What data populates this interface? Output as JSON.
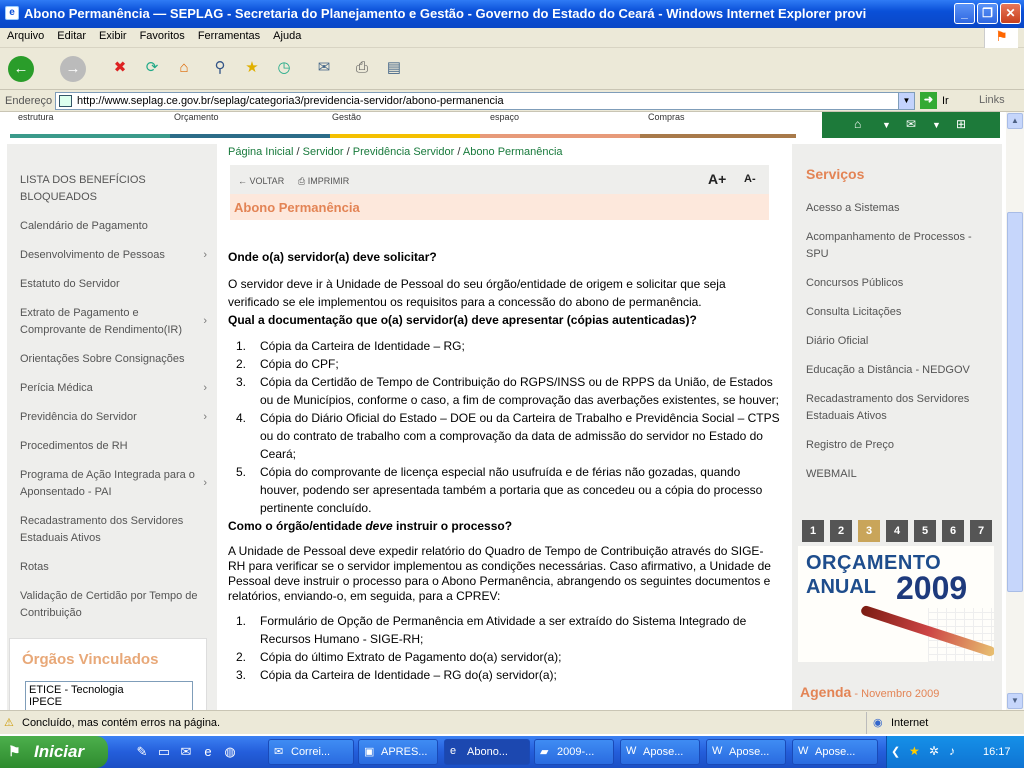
{
  "window": {
    "title": "Abono Permanência — SEPLAG - Secretaria do Planejamento e Gestão - Governo do Estado do Ceará - Windows Internet Explorer provi"
  },
  "menu": [
    "Arquivo",
    "Editar",
    "Exibir",
    "Favoritos",
    "Ferramentas",
    "Ajuda"
  ],
  "address": {
    "label": "Endereço",
    "url": "http://www.seplag.ce.gov.br/seplag/categoria3/previdencia-servidor/abono-permanencia",
    "go": "Ir",
    "links": "Links"
  },
  "topnav": [
    "estrutura",
    "Orçamento",
    "Gestão",
    "espaço",
    "Compras"
  ],
  "left_nav": {
    "items": [
      "LISTA DOS BENEFÍCIOS BLOQUEADOS",
      "Calendário de Pagamento",
      "Desenvolvimento de Pessoas",
      "Estatuto do Servidor",
      "Extrato de Pagamento e Comprovante de Rendimento(IR)",
      "Orientações Sobre Consignações",
      "Perícia Médica",
      "Previdência do Servidor",
      "Procedimentos de RH",
      "Programa de Ação Integrada para o Aponsentado - PAI",
      "Recadastramento dos Servidores Estaduais Ativos",
      "Rotas",
      "Validação de Certidão por Tempo de Contribuição"
    ],
    "orgs_title": "Órgãos Vinculados",
    "orgs": [
      "ETICE - Tecnologia",
      "IPECE"
    ]
  },
  "breadcrumb": [
    "Página Inicial",
    "Servidor",
    "Previdência Servidor",
    "Abono Permanência"
  ],
  "tools": {
    "back": "VOLTAR",
    "print": "IMPRIMIR",
    "font_up": "A+",
    "font_down": "A-"
  },
  "page_title": "Abono Permanência",
  "content": {
    "q1": "Onde o(a) servidor(a) deve solicitar?",
    "p1": "O servidor deve ir à Unidade de Pessoal do seu órgão/entidade de origem e solicitar que seja verificado se ele implementou os requisitos para a concessão do abono de permanência.",
    "q2": "Qual a documentação que o(a) servidor(a) deve apresentar (cópias autenticadas)?",
    "list1": [
      "Cópia da Carteira de Identidade – RG;",
      "Cópia do CPF;",
      "Cópia da Certidão de Tempo de Contribuição do RGPS/INSS ou de RPPS da União, de Estados ou de Municípios, conforme o caso, a fim de comprovação das averbações existentes, se houver;",
      "Cópia do Diário Oficial do Estado – DOE ou da Carteira de Trabalho e Previdência Social – CTPS ou do contrato de trabalho com a comprovação da data de admissão do servidor no Estado do Ceará;",
      "Cópia do comprovante de licença especial não usufruída e de férias não gozadas, quando houver, podendo ser apresentada também a portaria que as concedeu ou a cópia do processo pertinente concluído."
    ],
    "q3a": "Como o órgão/entidade ",
    "q3b": "deve",
    "q3c": " instruir o processo?",
    "p2": "A Unidade de Pessoal deve expedir relatório do Quadro de Tempo de Contribuição através do SIGE-RH para verificar se o servidor implementou as condições necessárias. Caso afirmativo, a Unidade de Pessoal deve instruir o processo para o Abono Permanência, abrangendo os seguintes documentos e relatórios, enviando-o, em seguida, para a CPREV:",
    "list2": [
      "Formulário de Opção de Permanência em Atividade a ser extraído do Sistema Integrado de Recursos Humano - SIGE-RH;",
      "Cópia do último Extrato de Pagamento do(a) servidor(a);",
      "Cópia da Carteira de Identidade – RG do(a) servidor(a);"
    ]
  },
  "right": {
    "title": "Serviços",
    "items": [
      "Acesso a Sistemas",
      "Acompanhamento de Processos - SPU",
      "Concursos Públicos",
      "Consulta Licitações",
      "Diário Oficial",
      "Educação a Distância - NEDGOV",
      "Recadastramento dos Servidores Estaduais Ativos",
      "Registro de Preço",
      "WEBMAIL"
    ],
    "pages": [
      "1",
      "2",
      "3",
      "4",
      "5",
      "6",
      "7"
    ],
    "banner": {
      "line1": "ORÇAMENTO",
      "line2": "ANUAL",
      "year": "2009"
    },
    "agenda": "Agenda",
    "agenda_month": " - Novembro 2009"
  },
  "status": {
    "text": "Concluído, mas contém erros na página.",
    "zone": "Internet"
  },
  "taskbar": {
    "start": "Iniciar",
    "tasks": [
      "Correi...",
      "APRES...",
      "Abono...",
      "2009-...",
      "Apose...",
      "Apose...",
      "Apose..."
    ],
    "clock": "16:17"
  }
}
